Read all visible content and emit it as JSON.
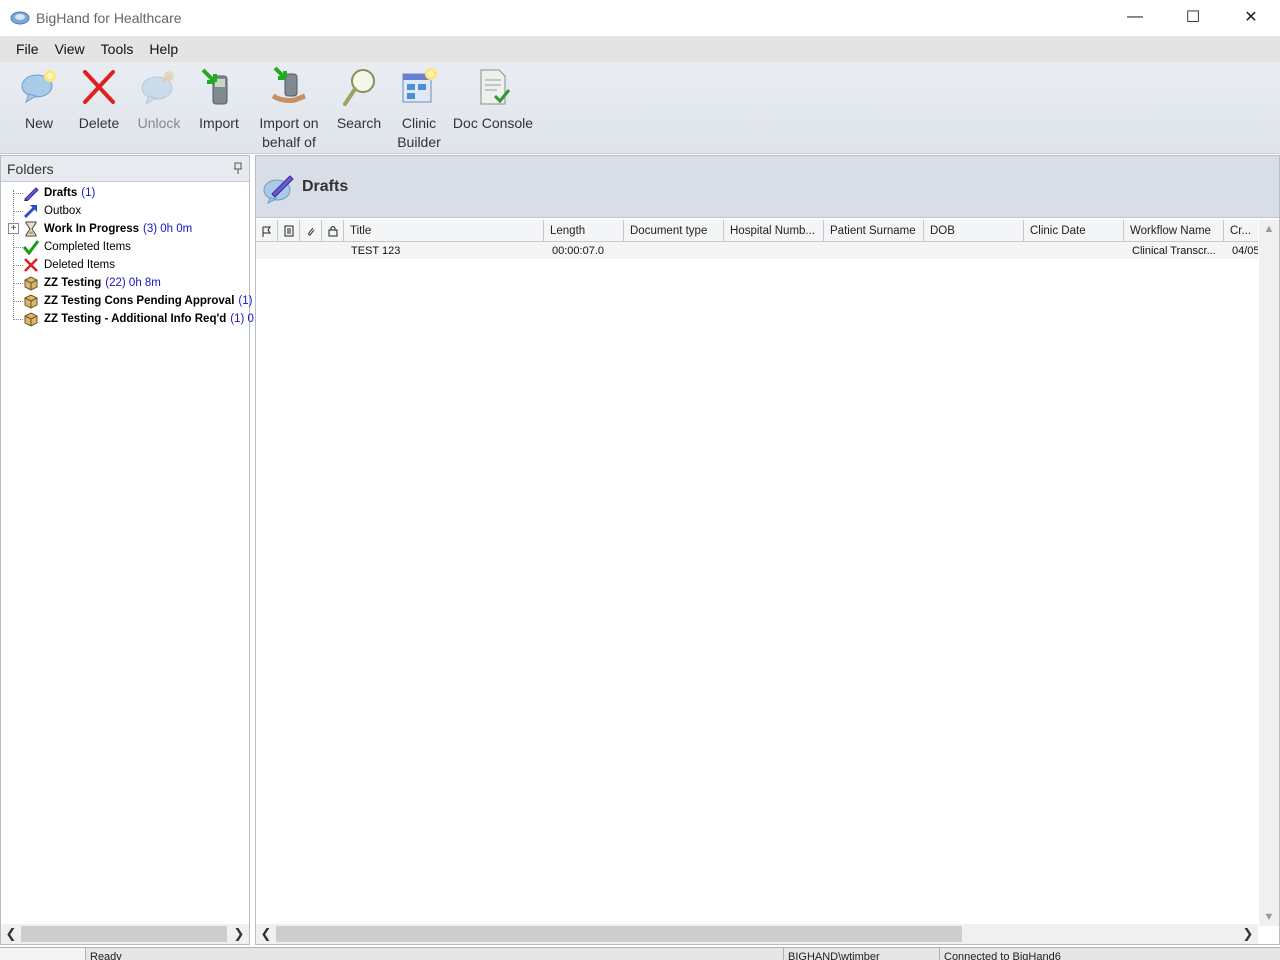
{
  "window": {
    "title": "BigHand for Healthcare",
    "minimize": "—",
    "maximize": "☐",
    "close": "✕"
  },
  "menu": [
    "File",
    "View",
    "Tools",
    "Help"
  ],
  "toolbar": [
    {
      "label": "New",
      "icon": "new-speech-icon",
      "enabled": true
    },
    {
      "label": "Delete",
      "icon": "delete-x-icon",
      "enabled": true
    },
    {
      "label": "Unlock",
      "icon": "unlock-icon",
      "enabled": false
    },
    {
      "label": "Import",
      "icon": "import-icon",
      "enabled": true
    },
    {
      "label": "Import on\nbehalf of",
      "icon": "import-behalf-icon",
      "enabled": true
    },
    {
      "label": "Search",
      "icon": "search-icon",
      "enabled": true
    },
    {
      "label": "Clinic\nBuilder",
      "icon": "clinic-builder-icon",
      "enabled": true
    },
    {
      "label": "Doc Console",
      "icon": "doc-console-icon",
      "enabled": true
    }
  ],
  "folders": {
    "header": "Folders",
    "items": [
      {
        "name": "Drafts",
        "count": "(1)",
        "bold": true,
        "icon": "drafts-pen-icon"
      },
      {
        "name": "Outbox",
        "count": "",
        "bold": false,
        "icon": "outbox-arrow-icon"
      },
      {
        "name": "Work In Progress",
        "count": "(3) 0h 0m",
        "bold": true,
        "icon": "hourglass-icon",
        "expandable": true
      },
      {
        "name": "Completed Items",
        "count": "",
        "bold": false,
        "icon": "checkmark-icon"
      },
      {
        "name": "Deleted Items",
        "count": "",
        "bold": false,
        "icon": "deleted-x-icon"
      },
      {
        "name": "ZZ Testing",
        "count": "(22) 0h 8m",
        "bold": true,
        "icon": "box-icon"
      },
      {
        "name": "ZZ Testing Cons Pending Approval",
        "count": "(1) 0",
        "bold": true,
        "icon": "box-icon"
      },
      {
        "name": "ZZ Testing - Additional Info Req'd",
        "count": "(1) 0",
        "bold": true,
        "icon": "box-icon"
      }
    ]
  },
  "content": {
    "title": "Drafts",
    "columns": [
      "Title",
      "Length",
      "Document type",
      "Hospital Numb...",
      "Patient Surname",
      "DOB",
      "Clinic Date",
      "Workflow Name",
      "Cr..."
    ],
    "rows": [
      {
        "title": "TEST 123",
        "length": "00:00:07.0",
        "doctype": "",
        "hospital": "",
        "surname": "",
        "dob": "",
        "clinic": "",
        "workflow": "Clinical Transcr...",
        "created": "04/05"
      }
    ]
  },
  "status": {
    "left": "Ready",
    "middle": "BIGHAND\\wtimber",
    "right": "Connected to BigHand6"
  },
  "colors": {
    "count_blue": "#1414c8",
    "toolbar_bg": "#e4e8ef",
    "header_bg": "#d9dee6"
  }
}
